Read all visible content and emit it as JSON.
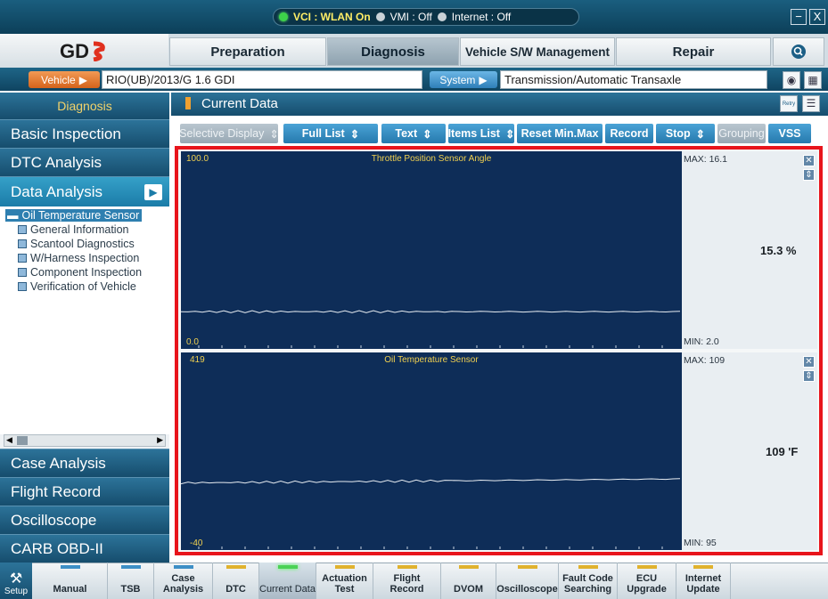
{
  "status": {
    "vci": "VCI : WLAN On",
    "vmi": "VMI : Off",
    "internet": "Internet : Off"
  },
  "window": {
    "minimize": "−",
    "close": "X"
  },
  "nav": {
    "logo": "GDS",
    "tabs": [
      "Preparation",
      "Diagnosis",
      "Vehicle S/W Management",
      "Repair"
    ],
    "active_tab": "Diagnosis"
  },
  "vehicle_row": {
    "vehicle_label": "Vehicle",
    "vehicle_value": "RIO(UB)/2013/G 1.6 GDI",
    "system_label": "System",
    "system_value": "Transmission/Automatic Transaxle"
  },
  "sidebar": {
    "header": "Diagnosis",
    "top_items": [
      "Basic Inspection",
      "DTC Analysis",
      "Data Analysis"
    ],
    "active_item": "Data Analysis",
    "tree": {
      "root": "Oil Temperature Sensor",
      "children": [
        "General Information",
        "Scantool Diagnostics",
        "W/Harness Inspection",
        "Component Inspection",
        "Verification of Vehicle"
      ]
    },
    "bottom_items": [
      "Case Analysis",
      "Flight Record",
      "Oscilloscope",
      "CARB OBD-II"
    ]
  },
  "main": {
    "title": "Current Data",
    "toolbar": [
      {
        "label": "Selective Display",
        "arrow": "⇕",
        "disabled": true
      },
      {
        "label": "Full List",
        "arrow": "⇕",
        "disabled": false
      },
      {
        "label": "Text",
        "arrow": "⇕",
        "disabled": false
      },
      {
        "label": "Items List",
        "arrow": "⇕",
        "disabled": false
      },
      {
        "label": "Reset Min.Max",
        "arrow": "",
        "disabled": false
      },
      {
        "label": "Record",
        "arrow": "",
        "disabled": false
      },
      {
        "label": "Stop",
        "arrow": "⇕",
        "disabled": false
      },
      {
        "label": "Grouping",
        "arrow": "",
        "disabled": true
      },
      {
        "label": "VSS",
        "arrow": "",
        "disabled": false
      }
    ],
    "retry_label": "Retry"
  },
  "plots": [
    {
      "title": "Throttle Position Sensor Angle",
      "y_top": "100.0",
      "y_bottom": "0.0",
      "max_label": "MAX: 16.1",
      "min_label": "MIN: 2.0",
      "current_value": "15.3 %",
      "line_level_fraction": 0.145
    },
    {
      "title": "Oil Temperature Sensor",
      "y_top": "419",
      "y_bottom": "-40",
      "max_label": "MAX: 109",
      "min_label": "MIN: 95",
      "current_value": "109 'F",
      "line_level_fraction": 0.32
    }
  ],
  "bottom_bar": {
    "setup_label": "Setup",
    "items": [
      {
        "label": "Manual",
        "indicator": "blue"
      },
      {
        "label": "TSB",
        "indicator": "blue"
      },
      {
        "label": "Case Analysis",
        "indicator": "blue"
      },
      {
        "label": "DTC",
        "indicator": "yellow"
      },
      {
        "label": "Current Data",
        "indicator": "green"
      },
      {
        "label": "Actuation Test",
        "indicator": "yellow"
      },
      {
        "label": "Flight Record",
        "indicator": "yellow"
      },
      {
        "label": "DVOM",
        "indicator": "yellow"
      },
      {
        "label": "Oscilloscope",
        "indicator": "yellow"
      },
      {
        "label": "Fault Code Searching",
        "indicator": "yellow"
      },
      {
        "label": "ECU Upgrade",
        "indicator": "yellow"
      },
      {
        "label": "Internet Update",
        "indicator": "yellow"
      }
    ],
    "active_item": "Current Data"
  },
  "colors": {
    "highlight_frame": "#e8141b",
    "plot_background": "#0e2d58",
    "accent_blue": "#2679ad"
  }
}
